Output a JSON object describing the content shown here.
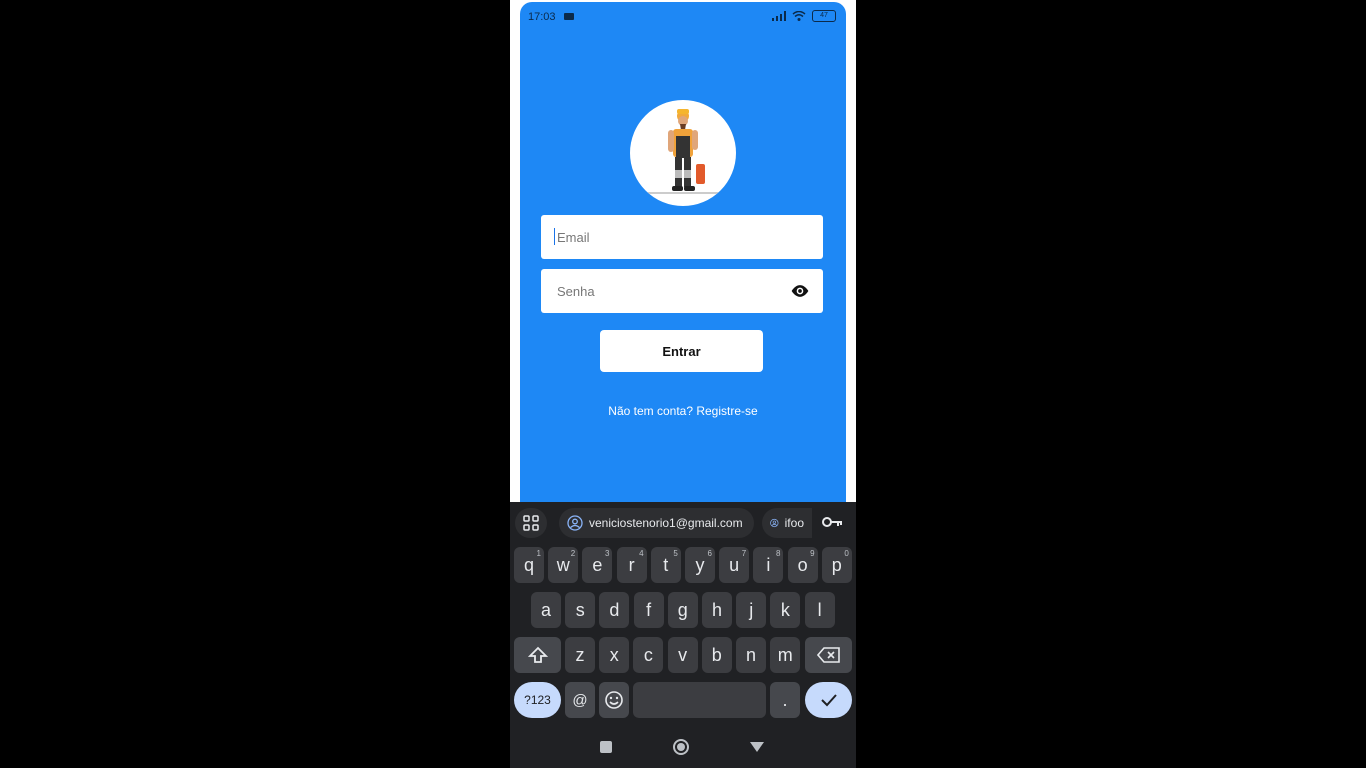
{
  "status_bar": {
    "time": "17:03",
    "battery": "47"
  },
  "form": {
    "email_placeholder": "Email",
    "password_placeholder": "Senha",
    "login_label": "Entrar",
    "register_link": "Não tem conta? Registre-se"
  },
  "keyboard": {
    "suggestions": [
      "veniciostenorio1@gmail.com",
      "ifoo"
    ],
    "row1": [
      {
        "k": "q",
        "n": "1"
      },
      {
        "k": "w",
        "n": "2"
      },
      {
        "k": "e",
        "n": "3"
      },
      {
        "k": "r",
        "n": "4"
      },
      {
        "k": "t",
        "n": "5"
      },
      {
        "k": "y",
        "n": "6"
      },
      {
        "k": "u",
        "n": "7"
      },
      {
        "k": "i",
        "n": "8"
      },
      {
        "k": "o",
        "n": "9"
      },
      {
        "k": "p",
        "n": "0"
      }
    ],
    "row2": [
      "a",
      "s",
      "d",
      "f",
      "g",
      "h",
      "j",
      "k",
      "l"
    ],
    "row3": [
      "z",
      "x",
      "c",
      "v",
      "b",
      "n",
      "m"
    ],
    "symbols_label": "?123",
    "at_label": "@",
    "period_label": "."
  },
  "colors": {
    "app_background": "#1e88f5",
    "keyboard_background": "#202124",
    "enter_key": "#c6dafc"
  }
}
